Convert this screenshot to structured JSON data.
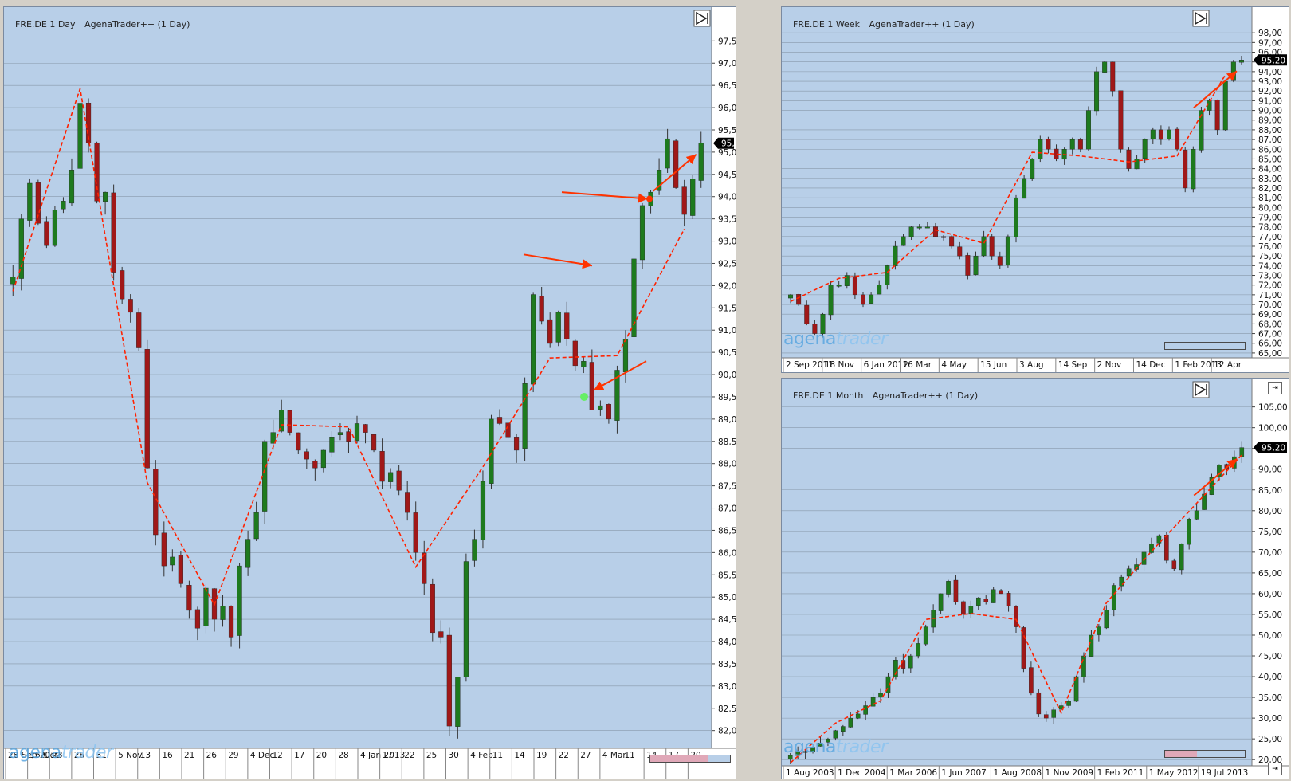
{
  "panels": {
    "daily": {
      "title_symbol": "FRE.DE 1 Day",
      "title_source": "AgenaTrader++ (1 Day)",
      "last_price": "95,20",
      "logo_a": "agena",
      "logo_b": "trader"
    },
    "weekly": {
      "title_symbol": "FRE.DE 1 Week",
      "title_source": "AgenaTrader++ (1 Day)",
      "last_price": "95,20",
      "logo_a": "agena",
      "logo_b": "trader"
    },
    "monthly": {
      "title_symbol": "FRE.DE 1 Month",
      "title_source": "AgenaTrader++ (1 Day)",
      "last_price": "95,20",
      "logo_a": "agena",
      "logo_b": "trader"
    }
  },
  "colors": {
    "up": "#1e7a1e",
    "down": "#a01818",
    "wick": "#333333",
    "arrow": "#ff3300",
    "zigzag": "#ff2200",
    "marker": "#66ee66",
    "grid": "#8899aa",
    "price_tag_bg": "#000000",
    "price_tag_fg": "#ffffff"
  },
  "chart_data": [
    {
      "id": "daily",
      "type": "candlestick",
      "title": "FRE.DE 1 Day  AgenaTrader++ (1 Day)",
      "ylim": [
        81.6,
        97.9
      ],
      "y_ticks": [
        "82,00",
        "82,50",
        "83,00",
        "83,50",
        "84,00",
        "84,50",
        "85,00",
        "85,50",
        "86,00",
        "86,50",
        "87,00",
        "87,50",
        "88,00",
        "88,50",
        "89,00",
        "89,50",
        "90,00",
        "90,50",
        "91,00",
        "91,50",
        "92,00",
        "92,50",
        "93,00",
        "93,50",
        "94,00",
        "94,50",
        "95,00",
        "95,50",
        "96,00",
        "96,50",
        "97,00",
        "97,50"
      ],
      "x_ticks": [
        "28 Sep 2012",
        "15 Oct",
        "23",
        "26",
        "31",
        "5 Nov",
        "13",
        "16",
        "21",
        "26",
        "29",
        "4 Dec",
        "12",
        "17",
        "20",
        "28",
        "4 Jan 2013",
        "17",
        "22",
        "25",
        "30",
        "4 Feb",
        "11",
        "14",
        "19",
        "22",
        "27",
        "4 Mar",
        "11",
        "14",
        "17",
        "20"
      ],
      "close_path": [
        92.2,
        93.5,
        94.3,
        93.4,
        92.9,
        93.7,
        93.9,
        94.6,
        96.1,
        95.2,
        93.9,
        94.1,
        92.3,
        91.7,
        91.4,
        90.6,
        87.9,
        86.4,
        85.7,
        85.9,
        85.3,
        84.7,
        84.3,
        85.2,
        84.5,
        84.8,
        84.1,
        85.7,
        86.3,
        86.9,
        88.5,
        88.7,
        89.2,
        88.7,
        88.3,
        88.1,
        87.9,
        88.3,
        88.6,
        88.7,
        88.5,
        88.9,
        88.7,
        88.3,
        87.6,
        87.8,
        87.4,
        86.9,
        86.0,
        85.3,
        84.2,
        84.1,
        82.1,
        83.2,
        85.8,
        86.3,
        87.6,
        89.0,
        88.9,
        88.6,
        88.3,
        89.8,
        91.8,
        91.2,
        90.7,
        91.4,
        90.8,
        90.2,
        90.3,
        89.2,
        89.3,
        89.0,
        90.1,
        90.8,
        92.6,
        93.8,
        94.1,
        94.6,
        95.3,
        94.2,
        93.6,
        94.4,
        95.2
      ],
      "last_price": 95.2,
      "legend": "none",
      "grid": true
    },
    {
      "id": "weekly",
      "type": "candlestick",
      "title": "FRE.DE 1 Week  AgenaTrader++ (1 Day)",
      "ylim": [
        64.5,
        99.0
      ],
      "y_ticks": [
        "65,00",
        "66,00",
        "67,00",
        "68,00",
        "69,00",
        "70,00",
        "71,00",
        "72,00",
        "73,00",
        "74,00",
        "75,00",
        "76,00",
        "77,00",
        "78,00",
        "79,00",
        "80,00",
        "81,00",
        "82,00",
        "83,00",
        "84,00",
        "85,00",
        "86,00",
        "87,00",
        "88,00",
        "89,00",
        "90,00",
        "91,00",
        "92,00",
        "93,00",
        "94,00",
        "95,00",
        "96,00",
        "97,00",
        "98,00"
      ],
      "x_ticks": [
        "2 Sep 2011",
        "18 Nov",
        "6 Jan 2012",
        "16 Mar",
        "4 May",
        "15 Jun",
        "3 Aug",
        "14 Sep",
        "2 Nov",
        "14 Dec",
        "1 Feb 2013",
        "12 Apr"
      ],
      "close_path": [
        71,
        70,
        68,
        67,
        69,
        72,
        72,
        73,
        71,
        70,
        71,
        72,
        74,
        76,
        77,
        78,
        78,
        78,
        77,
        77,
        76,
        75,
        73,
        75,
        77,
        75,
        74,
        77,
        81,
        83,
        85,
        87,
        86,
        85,
        86,
        87,
        86,
        90,
        94,
        95,
        92,
        86,
        84,
        85,
        87,
        88,
        87,
        88,
        86,
        82,
        86,
        90,
        91,
        88,
        93,
        95,
        95.2
      ],
      "last_price": 95.2,
      "legend": "none",
      "grid": true
    },
    {
      "id": "monthly",
      "type": "candlestick",
      "title": "FRE.DE 1 Month  AgenaTrader++ (1 Day)",
      "ylim": [
        18.5,
        108.0
      ],
      "y_ticks": [
        "20,00",
        "25,00",
        "30,00",
        "35,00",
        "40,00",
        "45,00",
        "50,00",
        "55,00",
        "60,00",
        "65,00",
        "70,00",
        "75,00",
        "80,00",
        "85,00",
        "90,00",
        "95,00",
        "100,00",
        "105,00"
      ],
      "x_ticks": [
        "1 Aug 2003",
        "1 Dec 2004",
        "1 Mar 2006",
        "1 Jun 2007",
        "1 Aug 2008",
        "1 Nov 2009",
        "1 Feb 2011",
        "1 May 2012",
        "19 Jul 2013"
      ],
      "close_path": [
        21,
        22,
        22,
        23,
        24,
        25,
        27,
        28,
        30,
        31,
        33,
        35,
        36,
        40,
        44,
        42,
        45,
        48,
        52,
        56,
        60,
        63,
        58,
        55,
        57,
        59,
        58,
        61,
        60,
        57,
        52,
        42,
        36,
        31,
        30,
        32,
        33,
        34,
        40,
        45,
        50,
        52,
        56,
        62,
        64,
        66,
        67,
        70,
        72,
        74,
        68,
        66,
        72,
        78,
        80,
        84,
        88,
        91,
        90,
        93,
        95.2
      ],
      "last_price": 95.2,
      "legend": "none",
      "grid": true
    }
  ]
}
